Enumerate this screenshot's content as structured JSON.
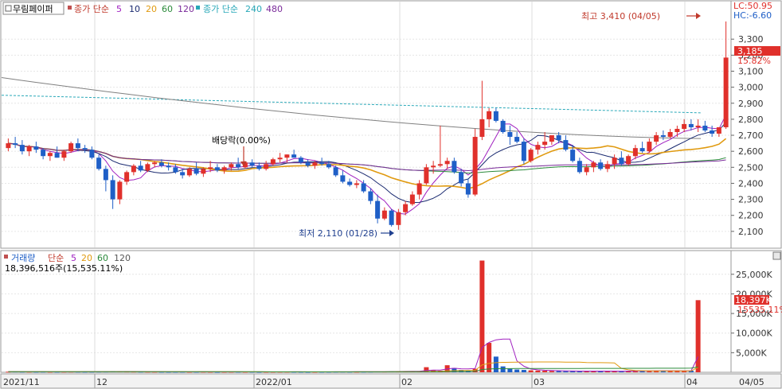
{
  "legend": {
    "stock_name": "무림페이퍼",
    "ma_label": "종가 단순",
    "ma_short": [
      "5",
      "10",
      "20",
      "60",
      "120"
    ],
    "ma_long_label": "종가 단순",
    "ma_long": [
      "240",
      "480"
    ]
  },
  "volume_legend": {
    "label": "거래량",
    "ma_label": "단순",
    "ma": [
      "5",
      "20",
      "60",
      "120"
    ],
    "current_value": "18,396,516주(15,535.11%)"
  },
  "lc_label": "LC:50.95",
  "hc_label": "HC:-6.60",
  "current_price_tag": "3,185",
  "current_change_tag": "15.82%",
  "volume_tag": "18,397K",
  "volume_pct_tag": "15535.11%",
  "annotations": {
    "high": "최고 3,410 (04/05)",
    "low": "최저 2,110 (01/28)",
    "dividend": "배당락(0.00%)"
  },
  "colors": {
    "up": "#e0302b",
    "down": "#1f5fc7",
    "ma5": "#a020c0",
    "ma10": "#1a2a70",
    "ma20": "#e09a10",
    "ma60": "#2a8a3a",
    "ma120": "#7a2a9a",
    "ma240": "#28a8b8",
    "ma480": "#808080"
  },
  "chart_data": [
    {
      "type": "candlestick",
      "title": "무림페이퍼",
      "ylim": [
        2000,
        3450
      ],
      "y_ticks": [
        "2,100",
        "2,200",
        "2,300",
        "2,400",
        "2,500",
        "2,600",
        "2,700",
        "2,800",
        "2,900",
        "3,000",
        "3,100",
        "3,200",
        "3,300"
      ],
      "x_labels": [
        "2021/11",
        "12",
        "2022/01",
        "02",
        "03",
        "04",
        "04/05"
      ],
      "candles": [
        [
          2620,
          2680,
          2600,
          2650
        ],
        [
          2650,
          2690,
          2620,
          2640
        ],
        [
          2640,
          2670,
          2580,
          2600
        ],
        [
          2600,
          2640,
          2570,
          2630
        ],
        [
          2630,
          2660,
          2590,
          2610
        ],
        [
          2610,
          2620,
          2550,
          2570
        ],
        [
          2570,
          2600,
          2540,
          2590
        ],
        [
          2590,
          2630,
          2560,
          2560
        ],
        [
          2560,
          2610,
          2540,
          2600
        ],
        [
          2600,
          2660,
          2590,
          2650
        ],
        [
          2650,
          2680,
          2600,
          2620
        ],
        [
          2620,
          2640,
          2590,
          2610
        ],
        [
          2610,
          2630,
          2550,
          2560
        ],
        [
          2560,
          2580,
          2480,
          2490
        ],
        [
          2490,
          2510,
          2350,
          2420
        ],
        [
          2420,
          2450,
          2240,
          2300
        ],
        [
          2300,
          2420,
          2270,
          2410
        ],
        [
          2410,
          2480,
          2390,
          2470
        ],
        [
          2470,
          2520,
          2450,
          2510
        ],
        [
          2510,
          2540,
          2470,
          2480
        ],
        [
          2480,
          2530,
          2470,
          2520
        ],
        [
          2520,
          2540,
          2500,
          2530
        ],
        [
          2530,
          2550,
          2500,
          2510
        ],
        [
          2510,
          2530,
          2480,
          2500
        ],
        [
          2500,
          2520,
          2460,
          2470
        ],
        [
          2470,
          2490,
          2430,
          2450
        ],
        [
          2450,
          2500,
          2440,
          2490
        ],
        [
          2490,
          2530,
          2450,
          2460
        ],
        [
          2460,
          2500,
          2440,
          2490
        ],
        [
          2490,
          2540,
          2470,
          2500
        ],
        [
          2500,
          2520,
          2470,
          2480
        ],
        [
          2480,
          2510,
          2460,
          2500
        ],
        [
          2500,
          2530,
          2480,
          2520
        ],
        [
          2520,
          2560,
          2490,
          2500
        ],
        [
          2500,
          2540,
          2490,
          2530
        ],
        [
          2530,
          2550,
          2500,
          2510
        ],
        [
          2510,
          2530,
          2480,
          2490
        ],
        [
          2490,
          2540,
          2480,
          2520
        ],
        [
          2520,
          2560,
          2510,
          2550
        ],
        [
          2550,
          2590,
          2530,
          2560
        ],
        [
          2560,
          2580,
          2530,
          2580
        ],
        [
          2580,
          2610,
          2560,
          2560
        ],
        [
          2560,
          2570,
          2520,
          2530
        ],
        [
          2530,
          2550,
          2500,
          2510
        ],
        [
          2510,
          2540,
          2490,
          2530
        ],
        [
          2530,
          2560,
          2510,
          2520
        ],
        [
          2520,
          2540,
          2490,
          2500
        ],
        [
          2500,
          2510,
          2440,
          2450
        ],
        [
          2450,
          2480,
          2400,
          2410
        ],
        [
          2410,
          2430,
          2380,
          2390
        ],
        [
          2390,
          2420,
          2370,
          2400
        ],
        [
          2400,
          2420,
          2340,
          2350
        ],
        [
          2350,
          2370,
          2270,
          2290
        ],
        [
          2290,
          2330,
          2150,
          2180
        ],
        [
          2180,
          2250,
          2170,
          2230
        ],
        [
          2230,
          2240,
          2130,
          2140
        ],
        [
          2140,
          2240,
          2110,
          2220
        ],
        [
          2220,
          2290,
          2200,
          2270
        ],
        [
          2270,
          2350,
          2260,
          2330
        ],
        [
          2330,
          2420,
          2300,
          2400
        ],
        [
          2400,
          2520,
          2390,
          2500
        ],
        [
          2500,
          2540,
          2460,
          2510
        ],
        [
          2510,
          2760,
          2500,
          2520
        ],
        [
          2520,
          2560,
          2490,
          2540
        ],
        [
          2540,
          2560,
          2460,
          2470
        ],
        [
          2470,
          2490,
          2380,
          2400
        ],
        [
          2400,
          2430,
          2310,
          2330
        ],
        [
          2330,
          2740,
          2320,
          2690
        ],
        [
          2690,
          3040,
          2670,
          2800
        ],
        [
          2800,
          2870,
          2750,
          2850
        ],
        [
          2850,
          2870,
          2780,
          2790
        ],
        [
          2790,
          2800,
          2710,
          2720
        ],
        [
          2720,
          2760,
          2640,
          2690
        ],
        [
          2690,
          2720,
          2650,
          2660
        ],
        [
          2660,
          2680,
          2520,
          2540
        ],
        [
          2540,
          2620,
          2530,
          2610
        ],
        [
          2610,
          2660,
          2580,
          2640
        ],
        [
          2640,
          2720,
          2610,
          2660
        ],
        [
          2660,
          2700,
          2640,
          2700
        ],
        [
          2700,
          2720,
          2650,
          2670
        ],
        [
          2670,
          2700,
          2600,
          2610
        ],
        [
          2610,
          2640,
          2530,
          2540
        ],
        [
          2540,
          2560,
          2460,
          2470
        ],
        [
          2470,
          2520,
          2450,
          2500
        ],
        [
          2500,
          2540,
          2470,
          2530
        ],
        [
          2530,
          2550,
          2480,
          2490
        ],
        [
          2490,
          2540,
          2470,
          2520
        ],
        [
          2520,
          2580,
          2490,
          2560
        ],
        [
          2560,
          2600,
          2510,
          2520
        ],
        [
          2520,
          2580,
          2510,
          2570
        ],
        [
          2570,
          2640,
          2550,
          2620
        ],
        [
          2620,
          2660,
          2590,
          2600
        ],
        [
          2600,
          2680,
          2590,
          2660
        ],
        [
          2660,
          2720,
          2640,
          2700
        ],
        [
          2700,
          2730,
          2670,
          2690
        ],
        [
          2690,
          2740,
          2680,
          2720
        ],
        [
          2720,
          2760,
          2690,
          2740
        ],
        [
          2740,
          2800,
          2720,
          2770
        ],
        [
          2770,
          2800,
          2730,
          2750
        ],
        [
          2750,
          2800,
          2720,
          2760
        ],
        [
          2760,
          2790,
          2720,
          2730
        ],
        [
          2730,
          2760,
          2690,
          2710
        ],
        [
          2710,
          2750,
          2690,
          2750
        ],
        [
          2750,
          3410,
          2740,
          3185
        ]
      ],
      "ma240": [
        2950,
        2840
      ],
      "ma480": [
        3060,
        2680
      ]
    },
    {
      "type": "bar",
      "title": "거래량",
      "ylim": [
        0,
        28000
      ],
      "y_ticks": [
        "5,000K",
        "10,000K",
        "15,000K",
        "20,000K",
        "25,000K"
      ],
      "values": [
        150,
        180,
        140,
        130,
        120,
        140,
        110,
        120,
        130,
        150,
        140,
        120,
        130,
        160,
        170,
        250,
        220,
        180,
        160,
        140,
        130,
        120,
        110,
        100,
        110,
        120,
        100,
        110,
        120,
        100,
        90,
        100,
        110,
        120,
        100,
        110,
        90,
        100,
        110,
        120,
        130,
        110,
        100,
        90,
        100,
        110,
        120,
        140,
        150,
        130,
        120,
        140,
        160,
        200,
        180,
        220,
        240,
        300,
        280,
        260,
        1300,
        600,
        400,
        1800,
        1100,
        600,
        500,
        900,
        28500,
        7500,
        4000,
        1500,
        900,
        700,
        600,
        500,
        450,
        400,
        350,
        300,
        280,
        300,
        320,
        340,
        300,
        280,
        260,
        300,
        320,
        350,
        380,
        400,
        420,
        450,
        400,
        380,
        360,
        350,
        400,
        18397
      ]
    }
  ]
}
